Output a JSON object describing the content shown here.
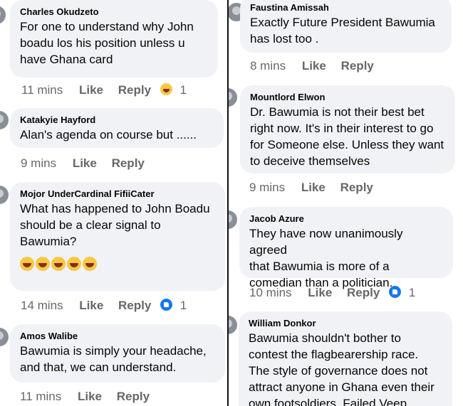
{
  "left_column": {
    "comments": [
      {
        "author": "Charles Okudzeto",
        "lines": [
          "For one to understand why John",
          "boadu los his position unless  u",
          "have Ghana card"
        ],
        "time": "11 mins",
        "like": "Like",
        "reply": "Reply",
        "reaction": "haha-icon",
        "reaction_count": "1"
      },
      {
        "author": "Katakyie Hayford",
        "lines": [
          "Alan's agenda on course but ......"
        ],
        "time": "9 mins",
        "like": "Like",
        "reply": "Reply"
      },
      {
        "author": "Mojor UnderCardinal FifiiCater",
        "lines": [
          "What has happened to John Boadu",
          "should be a clear signal to",
          "Bawumia?"
        ],
        "emojis": [
          "rofl-emoji",
          "rofl-emoji",
          "rofl-emoji",
          "rofl-emoji",
          "rofl-emoji"
        ],
        "time": "14 mins",
        "like": "Like",
        "reply": "Reply",
        "reaction": "like-icon",
        "reaction_count": "1"
      },
      {
        "author": "Amos Walibe",
        "lines": [
          "Bawumia is simply your headache,",
          "and that, we can understand."
        ],
        "time": "11 mins",
        "like": "Like",
        "reply": "Reply"
      }
    ]
  },
  "right_column": {
    "comments": [
      {
        "author": "Faustina Amissah",
        "lines": [
          "Exactly Future President Bawumia",
          "has lost too ."
        ],
        "time": "8 mins",
        "like": "Like",
        "reply": "Reply"
      },
      {
        "author": "Mountlord Elwon",
        "lines": [
          "Dr. Bawumia is not their best bet",
          "right now. It's in their interest to go",
          "for Someone else. Unless they want",
          "to deceive themselves"
        ],
        "time": "9 mins",
        "like": "Like",
        "reply": "Reply"
      },
      {
        "author": "Jacob Azure",
        "lines": [
          "They have now unanimously agreed",
          "that Bawumia is more of a",
          "comedian than a politician."
        ],
        "time": "10 mins",
        "like": "Like",
        "reply": "Reply",
        "reaction": "like-icon",
        "reaction_count": "1"
      },
      {
        "author": "William Donkor",
        "lines": [
          "Bawumia shouldn't bother to",
          "contest the flagbearership race.",
          "The style of governance does not",
          "attract anyone in Ghana even their",
          "own footsoldiers. Failed Veep"
        ]
      }
    ]
  },
  "colors": {
    "bubble": "#f0f2f5",
    "meta_text": "#65676b",
    "like_blue": "#1877f2",
    "haha_yellow": "#f7c844",
    "divider": "#111111"
  }
}
